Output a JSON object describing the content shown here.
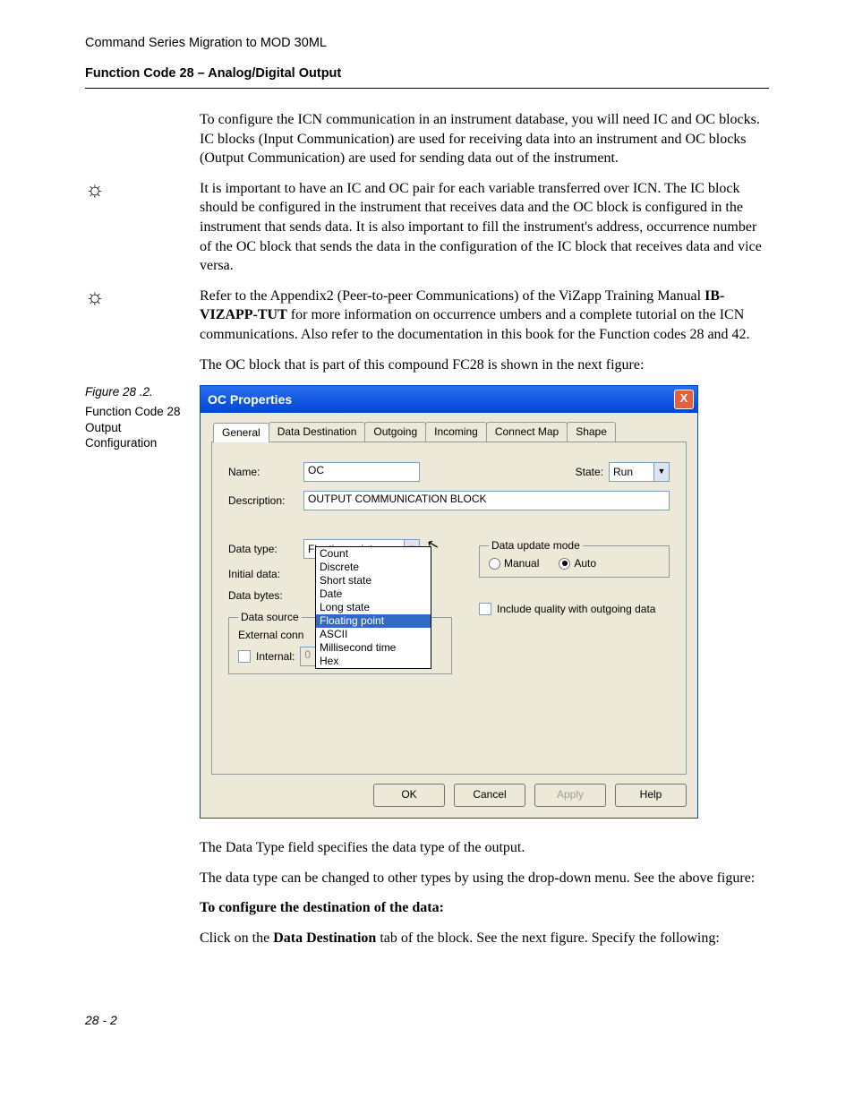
{
  "header": {
    "title": "Command Series Migration to MOD 30ML",
    "subtitle": "Function Code 28 – Analog/Digital Output"
  },
  "paragraphs": {
    "p1": "To configure the ICN communication in an instrument database, you will need IC and OC blocks. IC blocks (Input Communication) are used for receiving data into an instrument and OC blocks (Output Communication) are used for sending data out of the instrument.",
    "p2": "It is important to have an IC and OC pair for each variable transferred over ICN. The IC block should be configured in the instrument that receives data and the OC block is configured in the instrument that sends data. It is also important to fill the instrument's address, occurrence number of the OC block that sends the data in the configuration of the IC block that receives data and vice versa.",
    "p3_a": "Refer to the Appendix2 (Peer-to-peer Communications) of the ViZapp Training Manual ",
    "p3_bold": "IB-VIZAPP-TUT",
    "p3_b": " for more information on occurrence umbers and a complete tutorial on the ICN communications. Also refer to the documentation in this book for the Function codes 28 and 42.",
    "p4": "The OC block that is part of this compound FC28 is shown in the next figure:",
    "p5": "The Data Type field specifies the data type of the output.",
    "p6": "The data type can be changed to other types by using the drop-down menu. See the above figure:",
    "p7_bold": "To configure the destination of the data:",
    "p8_a": "Click on the ",
    "p8_bold": "Data Destination",
    "p8_b": " tab of the block. See the next figure. Specify the following:"
  },
  "figure": {
    "label": "Figure 28 .2.",
    "caption": "Function Code 28 Output Configuration"
  },
  "dialog": {
    "title": "OC Properties",
    "close": "X",
    "tabs": [
      "General",
      "Data Destination",
      "Outgoing",
      "Incoming",
      "Connect Map",
      "Shape"
    ],
    "labels": {
      "name": "Name:",
      "state": "State:",
      "description": "Description:",
      "datatype": "Data type:",
      "initialdata": "Initial data:",
      "databytes": "Data bytes:",
      "datasource": "Data source",
      "externalconn": "External conn",
      "internal": "Internal:",
      "dataupdate": "Data update mode",
      "manual": "Manual",
      "auto": "Auto",
      "includequality": "Include quality with outgoing data"
    },
    "values": {
      "name": "OC",
      "state": "Run",
      "description": "OUTPUT COMMUNICATION BLOCK",
      "datatype": "Floating point",
      "internal": "0"
    },
    "dropdown_options": [
      "Count",
      "Discrete",
      "Short state",
      "Date",
      "Long state",
      "Floating point",
      "ASCII",
      "Millisecond time",
      "Hex"
    ],
    "buttons": {
      "ok": "OK",
      "cancel": "Cancel",
      "apply": "Apply",
      "help": "Help"
    }
  },
  "pagenum": "28 - 2"
}
